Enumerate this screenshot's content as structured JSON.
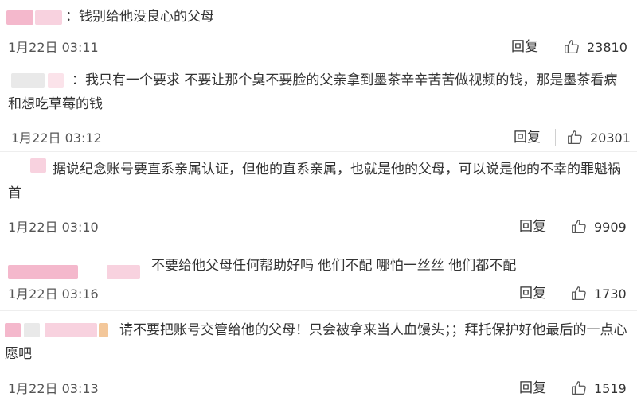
{
  "comments": [
    {
      "username": "",
      "text": "：钱别给他没良心的父母",
      "timestamp": "1月22日 03:11",
      "reply_label": "回复",
      "like_count": "23810"
    },
    {
      "username": "",
      "text": "：我只有一个要求  不要让那个臭不要脸的父亲拿到墨茶辛辛苦苦做视频的钱，那是墨茶看病  和想吃草莓的钱",
      "timestamp": "1月22日 03:12",
      "reply_label": "回复",
      "like_count": "20301"
    },
    {
      "username": "",
      "text": "据说纪念账号要直系亲属认证，但他的直系亲属，也就是他的父母，可以说是他的不幸的罪魁祸首",
      "timestamp": "1月22日 03:10",
      "reply_label": "回复",
      "like_count": "9909"
    },
    {
      "username": "",
      "text": "不要给他父母任何帮助好吗  他们不配    哪怕一丝丝  他们都不配",
      "timestamp": "1月22日 03:16",
      "reply_label": "回复",
      "like_count": "1730"
    },
    {
      "username": "",
      "text": "请不要把账号交管给他的父母！只会被拿来当人血馒头；；拜托保护好他最后的一点心愿吧",
      "timestamp": "1月22日 03:13",
      "reply_label": "回复",
      "like_count": "1519"
    }
  ],
  "icons": {
    "like": "thumbs-up-icon"
  },
  "colors": {
    "text": "#333333",
    "meta": "#555555",
    "avatar_blur_pink": "#f4b8cc",
    "avatar_blur_light_pink": "#fbe3ea",
    "avatar_blur_gray": "#e9e9e9",
    "avatar_blur_orange": "#f3c79a"
  }
}
